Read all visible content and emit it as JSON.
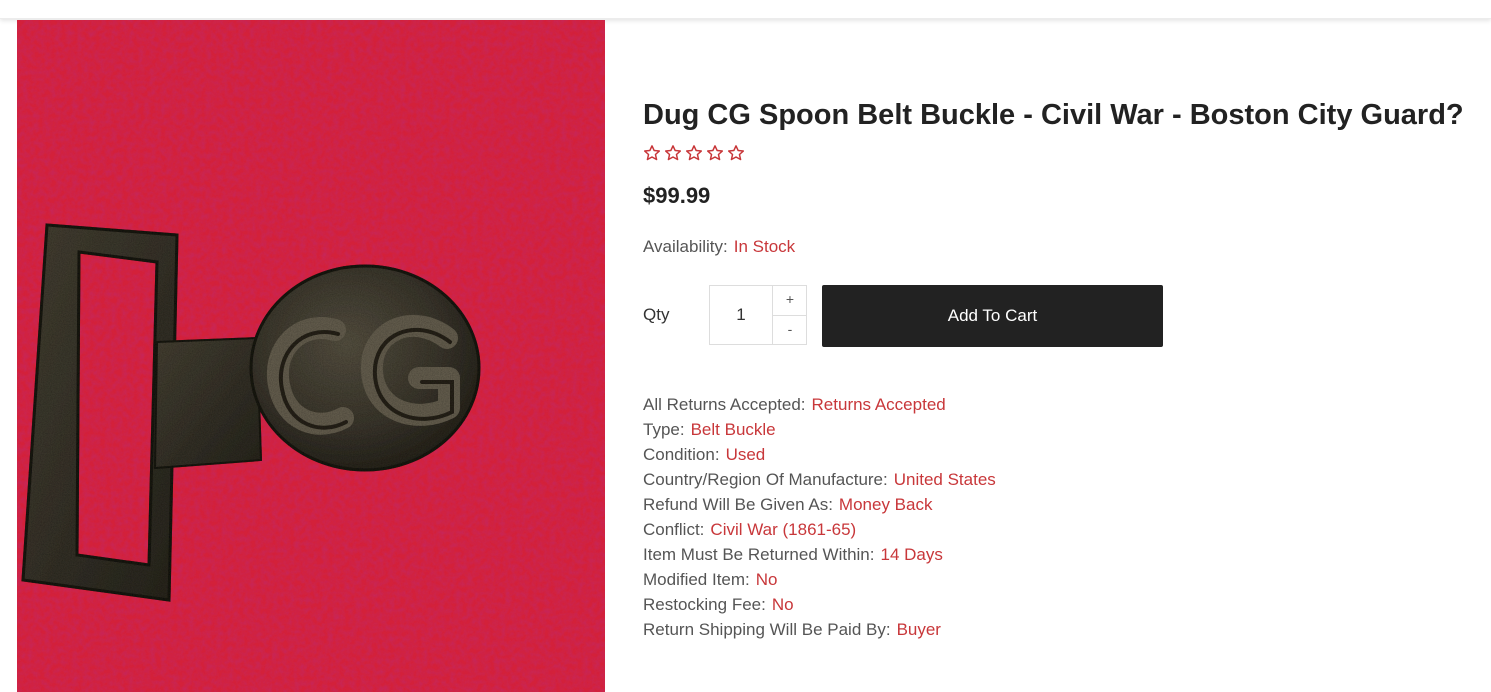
{
  "product": {
    "title": "Dug CG Spoon Belt Buckle - Civil War - Boston City Guard?",
    "rating_stars": 0,
    "rating_max": 5,
    "price": "$99.99",
    "availability_label": "Availability:",
    "availability_value": "In Stock",
    "image_alt": "Photo of a dug CG spoon belt buckle on a red towel"
  },
  "purchase": {
    "qty_label": "Qty",
    "qty_value": "1",
    "increment_label": "+",
    "decrement_label": "-",
    "add_to_cart_label": "Add To Cart"
  },
  "specs": [
    {
      "label": "All Returns Accepted:",
      "value": "Returns Accepted"
    },
    {
      "label": "Type:",
      "value": "Belt Buckle"
    },
    {
      "label": "Condition:",
      "value": "Used"
    },
    {
      "label": "Country/Region Of Manufacture:",
      "value": "United States"
    },
    {
      "label": "Refund Will Be Given As:",
      "value": "Money Back"
    },
    {
      "label": "Conflict:",
      "value": "Civil War (1861-65)"
    },
    {
      "label": "Item Must Be Returned Within:",
      "value": "14 Days"
    },
    {
      "label": "Modified Item:",
      "value": "No"
    },
    {
      "label": "Restocking Fee:",
      "value": "No"
    },
    {
      "label": "Return Shipping Will Be Paid By:",
      "value": "Buyer"
    }
  ],
  "colors": {
    "accent": "#c8373a",
    "button_bg": "#222222",
    "text_dark": "#222222",
    "text_muted": "#555555"
  },
  "icons": {
    "rating": "star-outline-icon"
  }
}
